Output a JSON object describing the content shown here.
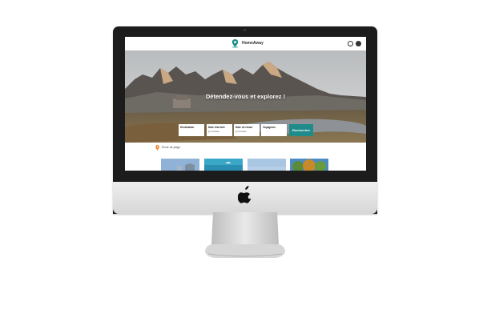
{
  "header": {
    "brand": "HomeAway"
  },
  "hero": {
    "title": "Détendez-vous et explorez !"
  },
  "search": {
    "fields": [
      {
        "label": "Destination",
        "value": ""
      },
      {
        "label": "Date d'arrivée",
        "value": "jj/mm/aaaa"
      },
      {
        "label": "Date de retour",
        "value": "jj/mm/aaaa"
      },
      {
        "label": "Voyageurs",
        "value": ""
      }
    ],
    "button_label": "Rechercher"
  },
  "section": {
    "title": "Envie de plage"
  },
  "colors": {
    "accent": "#1f8c8b",
    "pin_orange": "#e8862e"
  },
  "icons": {
    "logo": "location-pin-icon",
    "header_left": "help-icon",
    "header_right": "user-icon",
    "hardware_logo": "apple-icon"
  }
}
